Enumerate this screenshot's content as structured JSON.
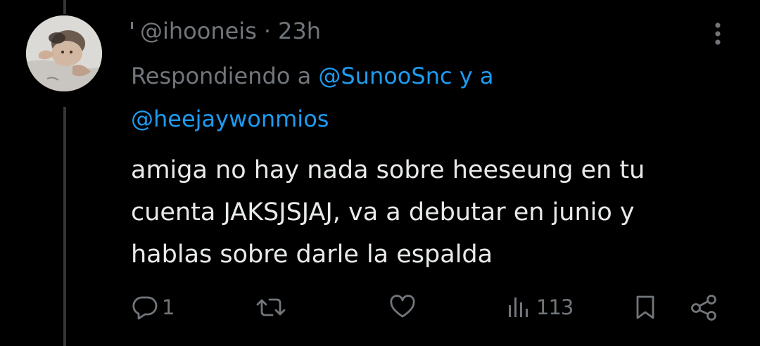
{
  "tweet": {
    "handle": "@ihooneis",
    "separator": "·",
    "time": "23h",
    "replying_prefix": "Respondiendo a",
    "mention_1": "@SunooSnc",
    "replying_joiner": "y a",
    "mention_2": "@heejaywonmios",
    "text_line_1": "amiga no hay nada sobre heeseung en tu",
    "text_line_2": "cuenta JAKSJSJAJ, va a debutar en junio y",
    "text_line_3": "hablas sobre darle la espalda"
  },
  "actions": {
    "reply_count": "1",
    "retweet_count": "",
    "like_count": "",
    "view_count": "113"
  },
  "icons": {
    "more": "more-vertical-icon",
    "reply": "reply-bubble-icon",
    "retweet": "retweet-icon",
    "like": "heart-icon",
    "views": "analytics-bars-icon",
    "bookmark": "bookmark-icon",
    "share": "share-icon"
  },
  "colors": {
    "background": "#000000",
    "text_primary": "#e7e9ea",
    "text_secondary": "#71767b",
    "link": "#1d9bf0"
  }
}
